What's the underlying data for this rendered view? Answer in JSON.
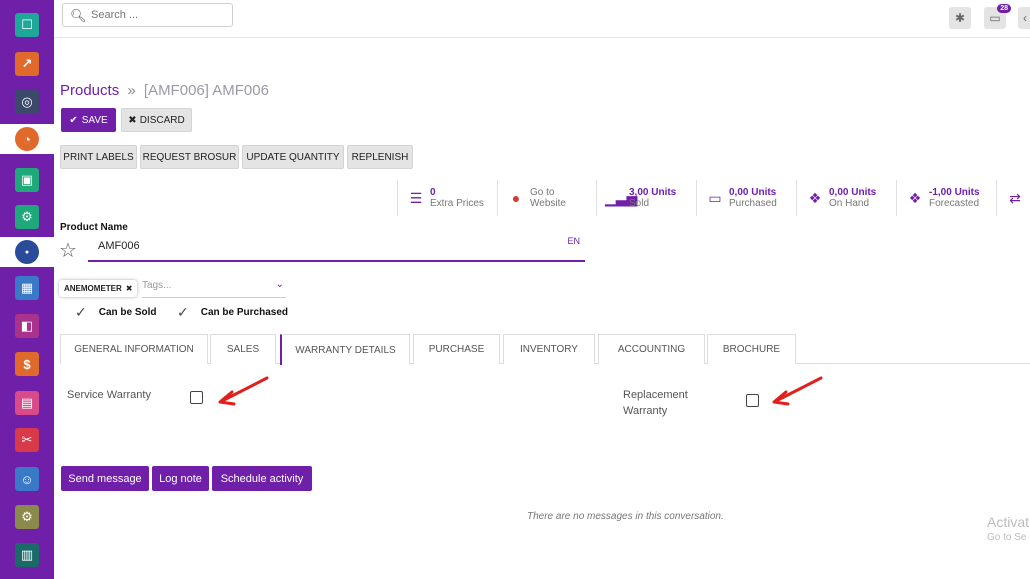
{
  "search": {
    "placeholder": "Search ..."
  },
  "topbar": {
    "messages_badge": "28"
  },
  "breadcrumb": {
    "parent": "Products",
    "separator": "»",
    "current": "[AMF006] AMF006"
  },
  "actions": {
    "save": "SAVE",
    "discard": "DISCARD"
  },
  "toolbar": {
    "print_labels": "PRINT LABELS",
    "request_brosur": "REQUEST BROSUR",
    "update_quantity": "UPDATE QUANTITY",
    "replenish": "REPLENISH"
  },
  "stats": [
    {
      "value": "0",
      "label": "Extra Prices",
      "icon": "list-icon"
    },
    {
      "value": "Go to",
      "label": "Website",
      "icon": "globe-icon"
    },
    {
      "value": "3,00 Units",
      "label": "Sold",
      "icon": "signal-icon"
    },
    {
      "value": "0,00 Units",
      "label": "Purchased",
      "icon": "credit-card-icon"
    },
    {
      "value": "0,00 Units",
      "label": "On Hand",
      "icon": "cubes-icon"
    },
    {
      "value": "-1,00 Units",
      "label": "Forecasted",
      "icon": "cubes-icon"
    }
  ],
  "product": {
    "name_label": "Product Name",
    "name_value": "AMF006",
    "lang": "EN",
    "tag": "ANEMOMETER",
    "tags_placeholder": "Tags...",
    "can_be_sold": "Can be Sold",
    "can_be_purchased": "Can be Purchased"
  },
  "tabs": [
    "GENERAL INFORMATION",
    "SALES",
    "WARRANTY DETAILS",
    "PURCHASE",
    "INVENTORY",
    "ACCOUNTING",
    "BROCHURE"
  ],
  "active_tab": "WARRANTY DETAILS",
  "warranty": {
    "service_label": "Service Warranty",
    "replacement_label_1": "Replacement",
    "replacement_label_2": "Warranty",
    "service_checked": false,
    "replacement_checked": false
  },
  "chatter": {
    "send_message": "Send message",
    "log_note": "Log note",
    "schedule_activity": "Schedule activity",
    "empty": "There are no messages in this conversation."
  },
  "watermark": {
    "line1": "Activat",
    "line2": "Go to Se"
  },
  "colors": {
    "brand": "#6f1fa8",
    "arrow": "#e0201c"
  }
}
